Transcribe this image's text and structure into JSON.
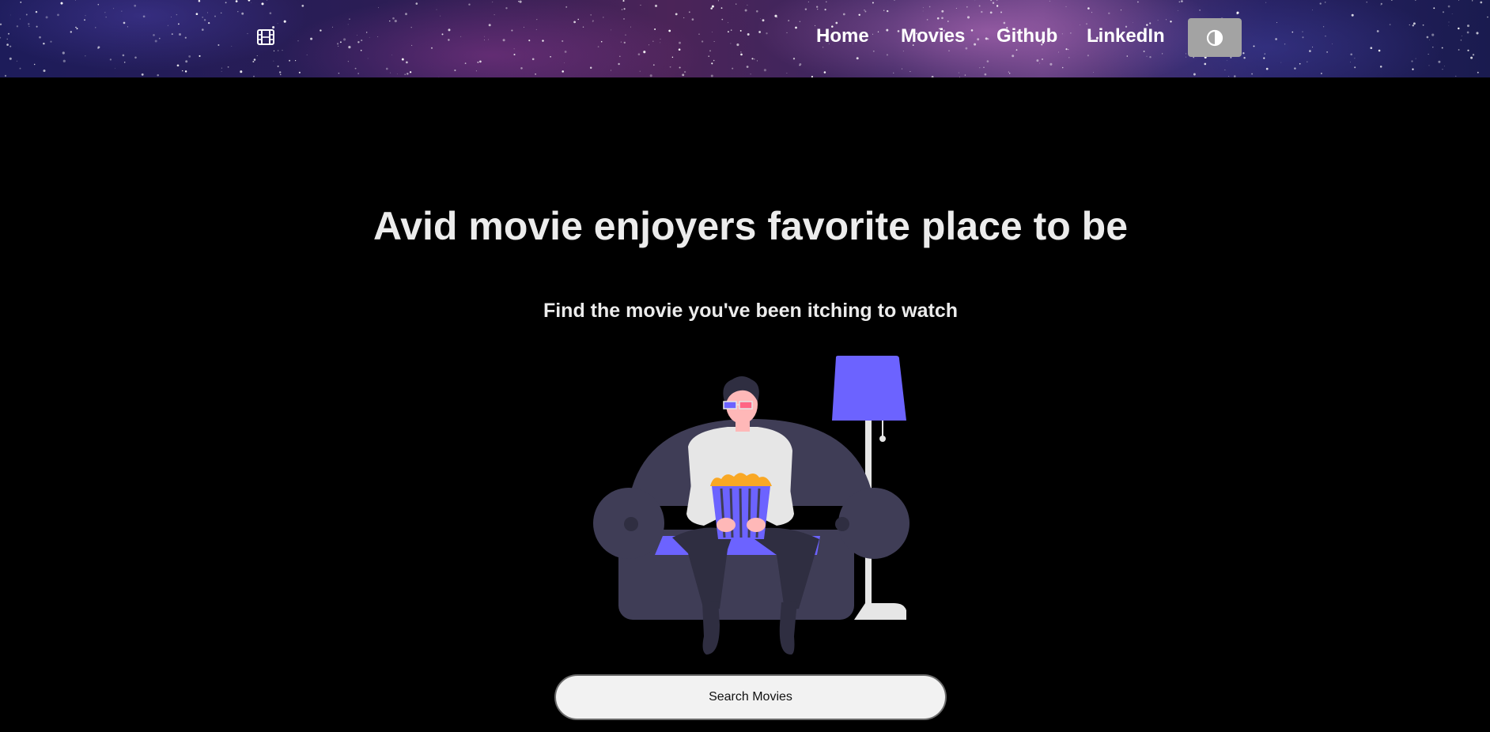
{
  "navbar": {
    "brand_icon": "film-icon",
    "links": [
      {
        "label": "Home"
      },
      {
        "label": "Movies"
      },
      {
        "label": "Github"
      },
      {
        "label": "LinkedIn"
      }
    ],
    "theme_toggle_icon": "contrast-icon"
  },
  "hero": {
    "title": "Avid movie enjoyers favorite place to be",
    "subtitle": "Find the movie you've been itching to watch",
    "illustration": "person-on-couch-with-popcorn-illustration",
    "cta_label": "Search Movies"
  },
  "colors": {
    "page_background": "#000000",
    "accent": "#6c63ff",
    "couch": "#3f3d56",
    "button_background": "#f2f2f2",
    "theme_button": "#a3a3a3"
  }
}
